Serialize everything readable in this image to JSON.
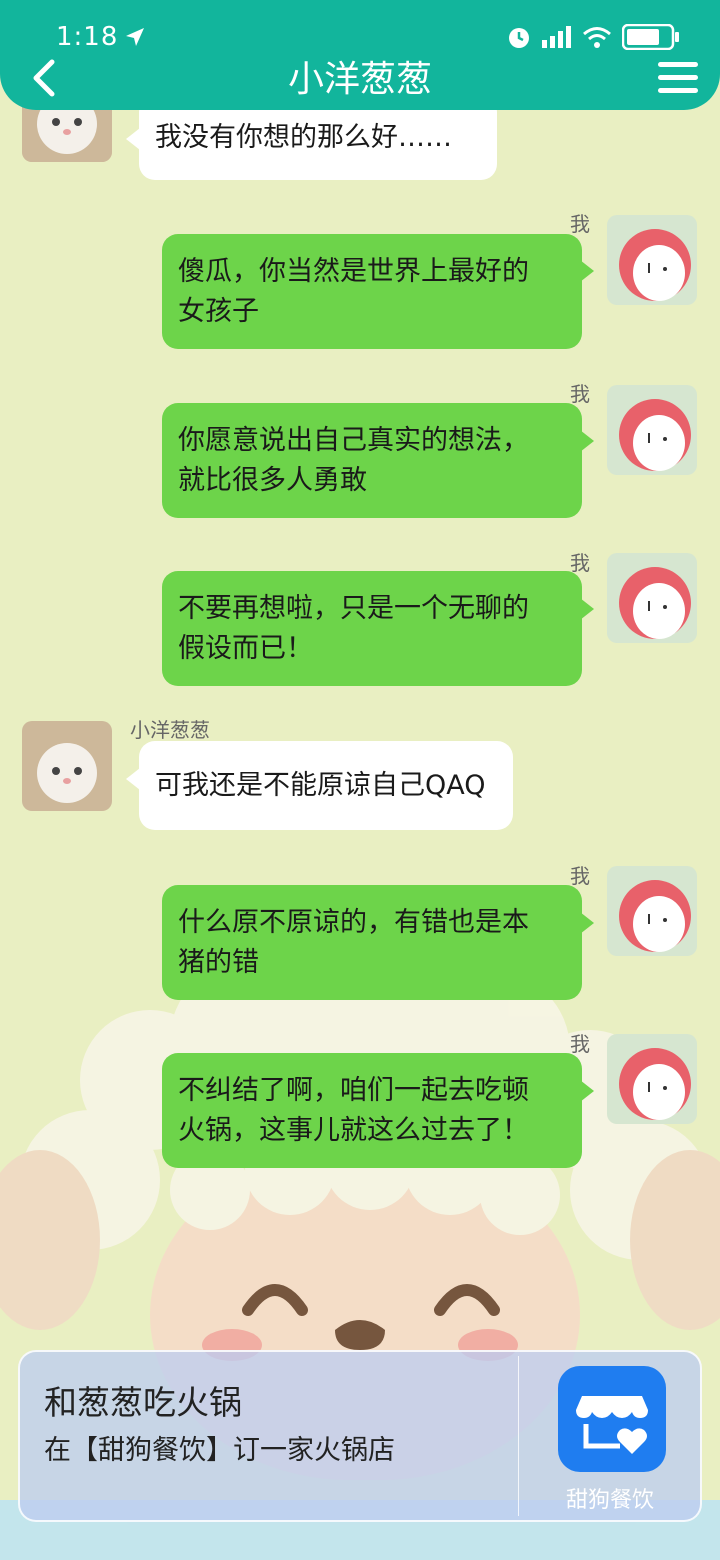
{
  "status_bar": {
    "time": "1:18"
  },
  "header": {
    "title": "小洋葱葱"
  },
  "messages": [
    {
      "from": "other",
      "sender": "",
      "text": "我没有你想的那么好……"
    },
    {
      "from": "me",
      "sender": "我",
      "line1": "傻瓜，你当然是世界上最好的",
      "line2": "女孩子"
    },
    {
      "from": "me",
      "sender": "我",
      "line1": "你愿意说出自己真实的想法，",
      "line2": "就比很多人勇敢"
    },
    {
      "from": "me",
      "sender": "我",
      "line1": "不要再想啦，只是一个无聊的",
      "line2": "假设而已！"
    },
    {
      "from": "other",
      "sender": "小洋葱葱",
      "text": "可我还是不能原谅自己QAQ"
    },
    {
      "from": "me",
      "sender": "我",
      "line1": "什么原不原谅的，有错也是本",
      "line2": "猪的错"
    },
    {
      "from": "me",
      "sender": "我",
      "line1": "不纠结了啊，咱们一起去吃顿",
      "line2": "火锅，这事儿就这么过去了！"
    }
  ],
  "card": {
    "title": "和葱葱吃火锅",
    "subtitle": "在【甜狗餐饮】订一家火锅店",
    "app_label": "甜狗餐饮"
  },
  "colors": {
    "header": "#12b59c",
    "my_bubble": "#6dd44a",
    "their_bubble": "#ffffff",
    "app_icon": "#1f7df0"
  },
  "icons": [
    "back-chevron-icon",
    "menu-icon",
    "location-arrow-icon",
    "alarm-icon",
    "signal-icon",
    "wifi-icon",
    "battery-icon",
    "store-heart-icon"
  ]
}
